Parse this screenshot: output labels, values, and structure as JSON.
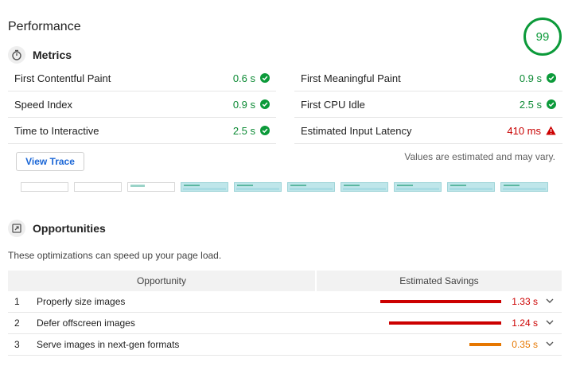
{
  "performance": {
    "title": "Performance",
    "score": "99"
  },
  "metrics": {
    "title": "Metrics",
    "icon": "stopwatch-icon",
    "left": [
      {
        "name": "First Contentful Paint",
        "value": "0.6 s",
        "status": "pass"
      },
      {
        "name": "Speed Index",
        "value": "0.9 s",
        "status": "pass"
      },
      {
        "name": "Time to Interactive",
        "value": "2.5 s",
        "status": "pass"
      }
    ],
    "right": [
      {
        "name": "First Meaningful Paint",
        "value": "0.9 s",
        "status": "pass"
      },
      {
        "name": "First CPU Idle",
        "value": "2.5 s",
        "status": "pass"
      },
      {
        "name": "Estimated Input Latency",
        "value": "410 ms",
        "status": "fail"
      }
    ],
    "view_trace_label": "View Trace",
    "estimate_note": "Values are estimated and may vary."
  },
  "opportunities": {
    "title": "Opportunities",
    "icon": "opportunity-icon",
    "description": "These optimizations can speed up your page load.",
    "col_opportunity": "Opportunity",
    "col_savings": "Estimated Savings",
    "rows": [
      {
        "num": "1",
        "name": "Properly size images",
        "savings": "1.33 s",
        "fraction": 1.0,
        "color": "#cc0000"
      },
      {
        "num": "2",
        "name": "Defer offscreen images",
        "savings": "1.24 s",
        "fraction": 0.93,
        "color": "#cc0000"
      },
      {
        "num": "3",
        "name": "Serve images in next-gen formats",
        "savings": "0.35 s",
        "fraction": 0.26,
        "color": "#e67700"
      }
    ]
  },
  "colors": {
    "pass": "#0c8a34",
    "fail": "#c80000",
    "average": "#e67700",
    "link": "#1a66d6"
  }
}
